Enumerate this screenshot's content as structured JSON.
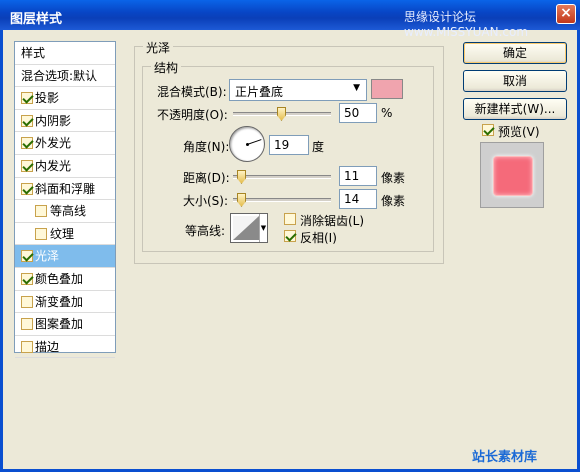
{
  "window": {
    "title": "图层样式",
    "watermark": "思缘设计论坛 www.MISSYUAN.com",
    "close_glyph": "×"
  },
  "style_list": {
    "header": "样式",
    "blend_default": "混合选项:默认",
    "items": [
      {
        "label": "投影",
        "checked": true,
        "indent": false,
        "selected": false
      },
      {
        "label": "内阴影",
        "checked": true,
        "indent": false,
        "selected": false
      },
      {
        "label": "外发光",
        "checked": true,
        "indent": false,
        "selected": false
      },
      {
        "label": "内发光",
        "checked": true,
        "indent": false,
        "selected": false
      },
      {
        "label": "斜面和浮雕",
        "checked": true,
        "indent": false,
        "selected": false
      },
      {
        "label": "等高线",
        "checked": false,
        "indent": true,
        "selected": false
      },
      {
        "label": "纹理",
        "checked": false,
        "indent": true,
        "selected": false
      },
      {
        "label": "光泽",
        "checked": true,
        "indent": false,
        "selected": true
      },
      {
        "label": "颜色叠加",
        "checked": true,
        "indent": false,
        "selected": false
      },
      {
        "label": "渐变叠加",
        "checked": false,
        "indent": false,
        "selected": false
      },
      {
        "label": "图案叠加",
        "checked": false,
        "indent": false,
        "selected": false
      },
      {
        "label": "描边",
        "checked": false,
        "indent": false,
        "selected": false
      }
    ]
  },
  "satin": {
    "group_title": "光泽",
    "structure_title": "结构",
    "blend_mode_label": "混合模式(B):",
    "blend_mode_value": "正片叠底",
    "color": "#f0a4ae",
    "opacity_label": "不透明度(O):",
    "opacity_value": "50",
    "opacity_unit": "%",
    "angle_label": "角度(N):",
    "angle_value": "19",
    "angle_unit": "度",
    "distance_label": "距离(D):",
    "distance_value": "11",
    "distance_unit": "像素",
    "size_label": "大小(S):",
    "size_value": "14",
    "size_unit": "像素",
    "contour_label": "等高线:",
    "antialias_label": "消除锯齿(L)",
    "antialias_checked": false,
    "invert_label": "反相(I)",
    "invert_checked": true
  },
  "buttons": {
    "ok": "确定",
    "cancel": "取消",
    "new_style": "新建样式(W)...",
    "preview_label": "预览(V)",
    "preview_checked": true
  },
  "preview_color": "#f56a7a",
  "corner_logo": "站长素材库"
}
